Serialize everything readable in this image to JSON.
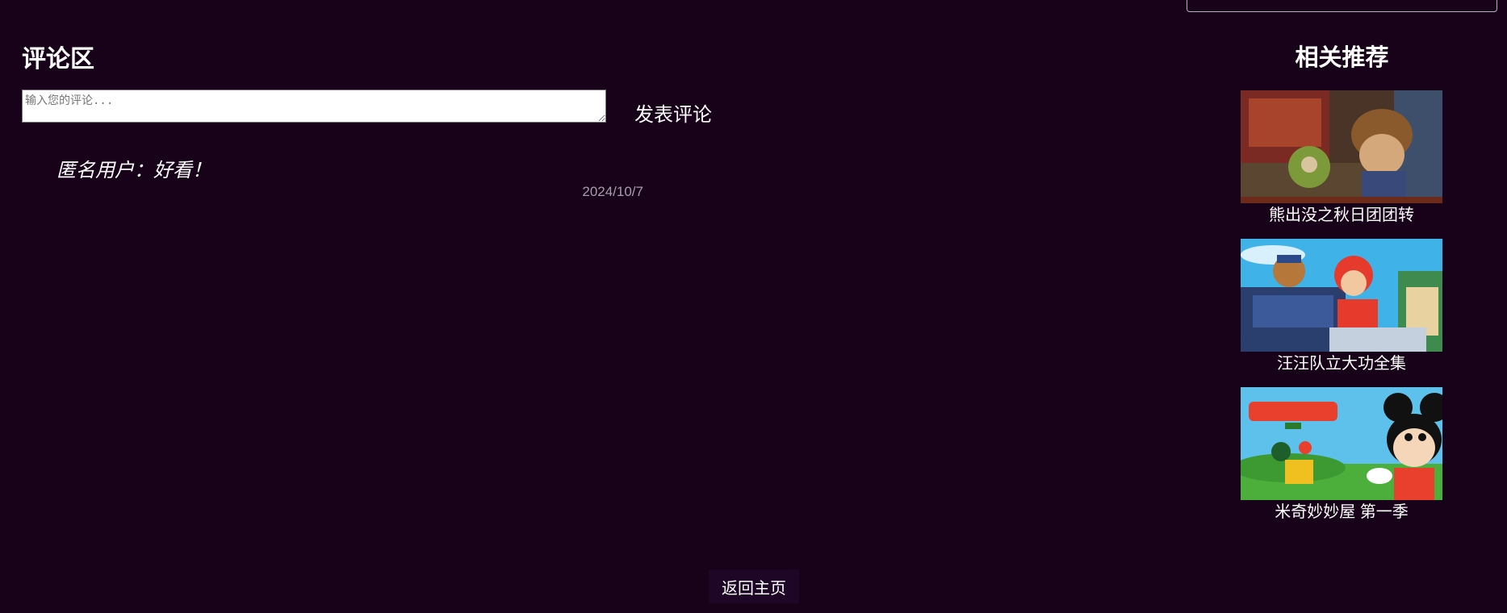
{
  "comments": {
    "title": "评论区",
    "input_placeholder": "输入您的评论...",
    "submit_label": "发表评论",
    "items": [
      {
        "text": "匿名用户：好看！",
        "date": "2024/10/7"
      }
    ]
  },
  "recommendations": {
    "title": "相关推荐",
    "items": [
      {
        "label": "熊出没之秋日团团转"
      },
      {
        "label": "汪汪队立大功全集"
      },
      {
        "label": "米奇妙妙屋 第一季"
      }
    ]
  },
  "footer": {
    "home_label": "返回主页"
  }
}
